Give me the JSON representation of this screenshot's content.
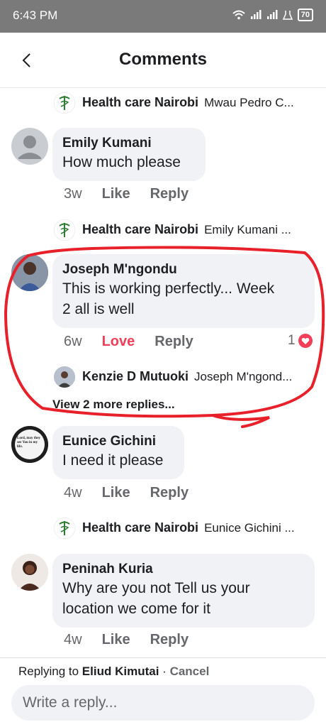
{
  "status_bar": {
    "time": "6:43 PM",
    "battery": "70"
  },
  "header": {
    "title": "Comments"
  },
  "comments": [
    {
      "reply_preview": {
        "author": "Health care Nairobi",
        "text": "Mwau Pedro C..."
      }
    },
    {
      "author": "Emily Kumani",
      "text": "How much please",
      "time": "3w",
      "like": "Like",
      "reply": "Reply",
      "reply_preview": {
        "author": "Health care Nairobi",
        "text": "Emily Kumani ..."
      }
    },
    {
      "author": "Joseph M'ngondu",
      "text_line1": "This is working perfectly... Week",
      "text_line2": "2 all is well",
      "time": "6w",
      "like": "Love",
      "reply": "Reply",
      "reaction_count": "1",
      "reply_preview": {
        "author": "Kenzie D Mutuoki",
        "text": "Joseph M'ngond..."
      },
      "view_more": "View 2 more replies..."
    },
    {
      "author": "Eunice Gichini",
      "text": "I need it please",
      "time": "4w",
      "like": "Like",
      "reply": "Reply",
      "avatar_text": "Lord, may they see You in my life.",
      "reply_preview": {
        "author": "Health care Nairobi",
        "text": "Eunice Gichini ..."
      }
    },
    {
      "author": "Peninah Kuria",
      "text_line1": "Why are you not Tell us your",
      "text_line2": "location we come for it",
      "time": "4w",
      "like": "Like",
      "reply": "Reply"
    }
  ],
  "composer": {
    "replying_prefix": "Replying to",
    "replying_to": "Eliud Kimutai",
    "separator": "·",
    "cancel": "Cancel",
    "placeholder": "Write a reply..."
  },
  "colors": {
    "love": "#f33e58",
    "bubble": "#f0f2f5",
    "annotation": "#e8202a",
    "status_bar": "#7a7a7a"
  }
}
